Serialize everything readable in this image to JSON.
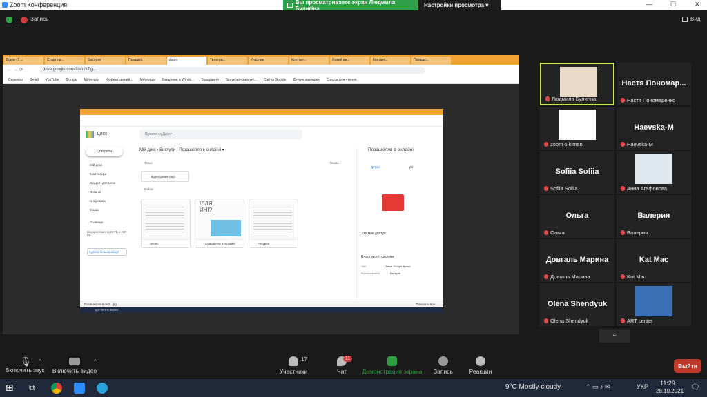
{
  "window": {
    "title": "Zoom Конференция",
    "buttons": [
      "—",
      "☐",
      "✕"
    ]
  },
  "share_banner": {
    "text": "Вы просматриваете экран Людмила Булигіна",
    "options": "Настройки просмотра ▾"
  },
  "top": {
    "record_label": "Запись",
    "view_label": "Вид"
  },
  "shared": {
    "tabs": [
      "Відео (7 ...",
      "Старт пр...",
      "Виступи",
      "Позашкі...",
      "zoom",
      "Телегра...",
      "Учасник",
      "Контакт...",
      "Новий ви...",
      "Контакт...",
      "Позашк..."
    ],
    "url": "drive.google.com/file/d/1Tgt...",
    "bookmarks": [
      "Сервисы",
      "Gmail",
      "YouTube",
      "Google",
      "Мої курси",
      "Форматований...",
      "Мої курси",
      "Введение в Windo...",
      "Вкладання",
      "Всеукраїнська уні...",
      "Сайты Google",
      "Другие закладки",
      "Список для чтения"
    ],
    "inner": {
      "drive_name": "Диск",
      "search_placeholder": "Шукати на Диску",
      "new_button": "Створити",
      "sidebar": [
        "Мій диск",
        "Комп'ютери",
        "Відкриті для мене",
        "Останні",
        "Із зірочкою",
        "Кошик",
        "Сховище"
      ],
      "storage": "Використано: 0,18 ГБ з 100 ГБ",
      "buy_storage": "Купити більше місця",
      "breadcrumb": "Мій диск  ›  Виступи  ›  Позашкілля в онлайні ▾",
      "folders_label": "Папки",
      "sort_label": "Назва ↑",
      "folder_name": "відеопрезентації",
      "files_label": "Файли",
      "files": [
        "Анонс",
        "Позашкілля в онлайні",
        "Ресурси"
      ],
      "details": {
        "title": "Позашкілля в онлайні",
        "tab1": "Деталі",
        "tab2": "Дії",
        "access": "Хто має доступ",
        "props": "Властивості системи",
        "type_label": "Тип",
        "type_value": "Папка Google Диска",
        "loc_label": "Розташування",
        "loc_value": "Виступи"
      },
      "download": "Позашкілля в онл...jpg",
      "show_all": "Показати все",
      "taskbar_search": "Type here to search"
    }
  },
  "participants": [
    {
      "name": "Людмила Булигіна",
      "active": true,
      "photo": true
    },
    {
      "name": "Настя Пономаренко",
      "display": "Настя Пономар..."
    },
    {
      "name": "zoom 6 kiman",
      "photo": true
    },
    {
      "name": "Haevska-M",
      "display": "Haevska-M"
    },
    {
      "name": "Sofiia Sofiia",
      "display": "Sofiia Sofiia"
    },
    {
      "name": "Анна Агафонова",
      "photo": true
    },
    {
      "name": "Ольга",
      "display": "Ольга"
    },
    {
      "name": "Валерия",
      "display": "Валерия"
    },
    {
      "name": "Довгаль Марина",
      "display": "Довгаль Марина"
    },
    {
      "name": "Kat Mac",
      "display": "Kat Mac"
    },
    {
      "name": "Olena Shendyuk",
      "display": "Olena Shendyuk"
    },
    {
      "name": "ART center",
      "photo": true
    }
  ],
  "toolbar": {
    "mute": "Включить звук",
    "video": "Включить видео",
    "participants": "Участники",
    "participants_count": "17",
    "chat": "Чат",
    "chat_badge": "11",
    "share": "Демонстрация экрана",
    "record": "Запись",
    "reactions": "Реакции",
    "exit": "Выйти"
  },
  "taskbar": {
    "weather": "9°C  Mostly cloudy",
    "lang": "УКР",
    "time": "11:29",
    "date": "28.10.2021"
  },
  "colors": {
    "share_green": "#2e9e48",
    "exit_red": "#c0392b",
    "active_border": "#c7e84a",
    "tab_orange": "#f0a232"
  }
}
